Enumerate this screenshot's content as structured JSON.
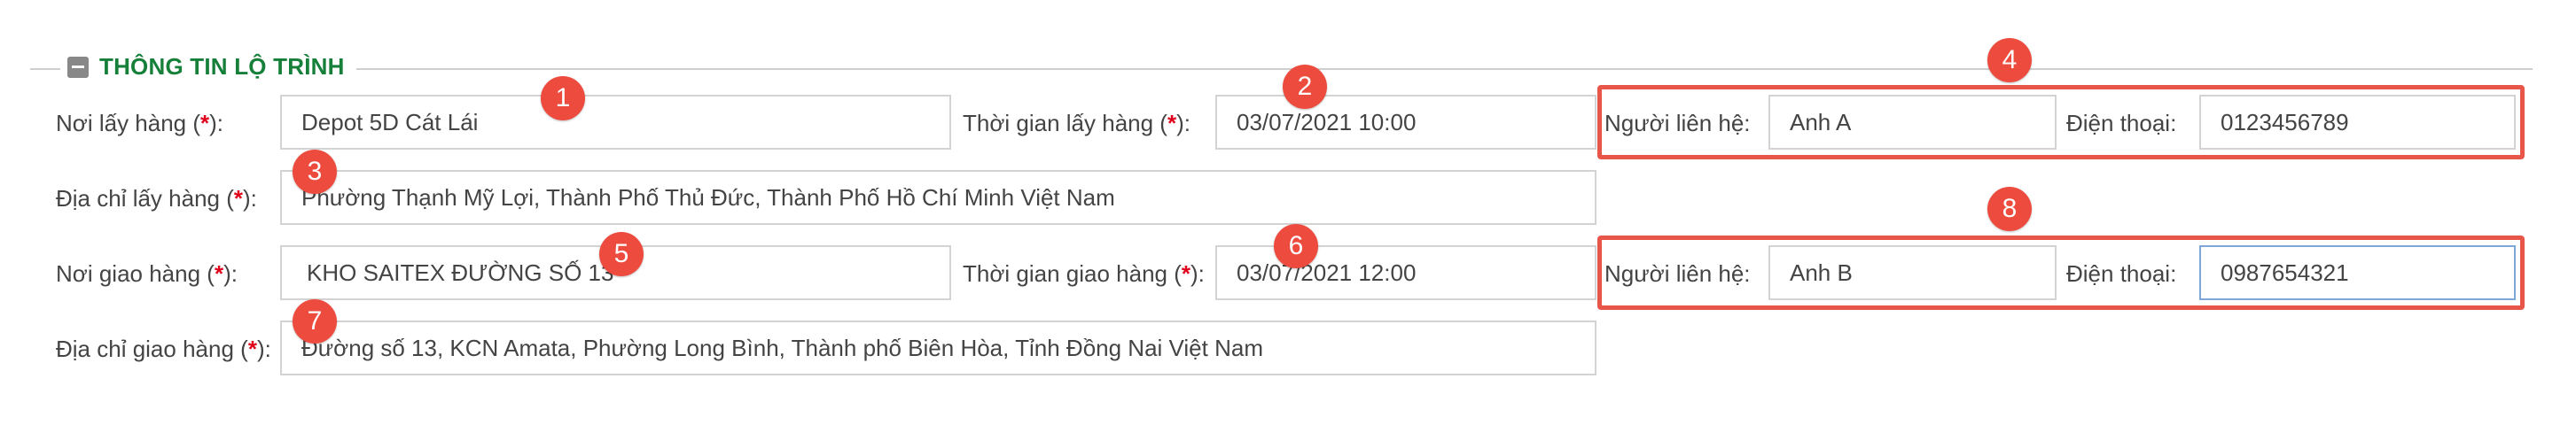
{
  "section": {
    "title": "THÔNG TIN LỘ TRÌNH"
  },
  "pickup": {
    "place_label": "Nơi lấy hàng (",
    "place_value": "Depot 5D  Cát Lái",
    "time_label": "Thời gian lấy hàng (",
    "time_value": "03/07/2021 10:00",
    "address_label": "Địa chỉ lấy hàng (",
    "address_value": "Phường Thạnh Mỹ Lợi, Thành Phố Thủ Đức, Thành Phố Hồ Chí Minh Việt Nam",
    "contact_label": "Người liên hệ:",
    "contact_value": "Anh  A",
    "phone_label": "Điện thoại:",
    "phone_value": "0123456789"
  },
  "delivery": {
    "place_label": "Nơi giao hàng (",
    "place_value": "KHO SAITEX ĐƯỜNG SỐ 13",
    "time_label": "Thời gian giao hàng (",
    "time_value": "03/07/2021 12:00",
    "address_label": "Địa chỉ giao hàng (",
    "address_value": "Đường số 13, KCN Amata, Phường Long Bình, Thành phố Biên Hòa, Tỉnh Đồng Nai Việt Nam",
    "contact_label": "Người liên hệ:",
    "contact_value": "Anh B",
    "phone_label": "Điện thoại:",
    "phone_value": "0987654321"
  },
  "required_mark": "*",
  "label_suffix": "):",
  "badges": [
    "1",
    "2",
    "3",
    "4",
    "5",
    "6",
    "7",
    "8"
  ],
  "colors": {
    "legend": "#16803a",
    "required": "#e0001b",
    "highlight": "#e8564a",
    "badge": "#ee4b3f"
  }
}
